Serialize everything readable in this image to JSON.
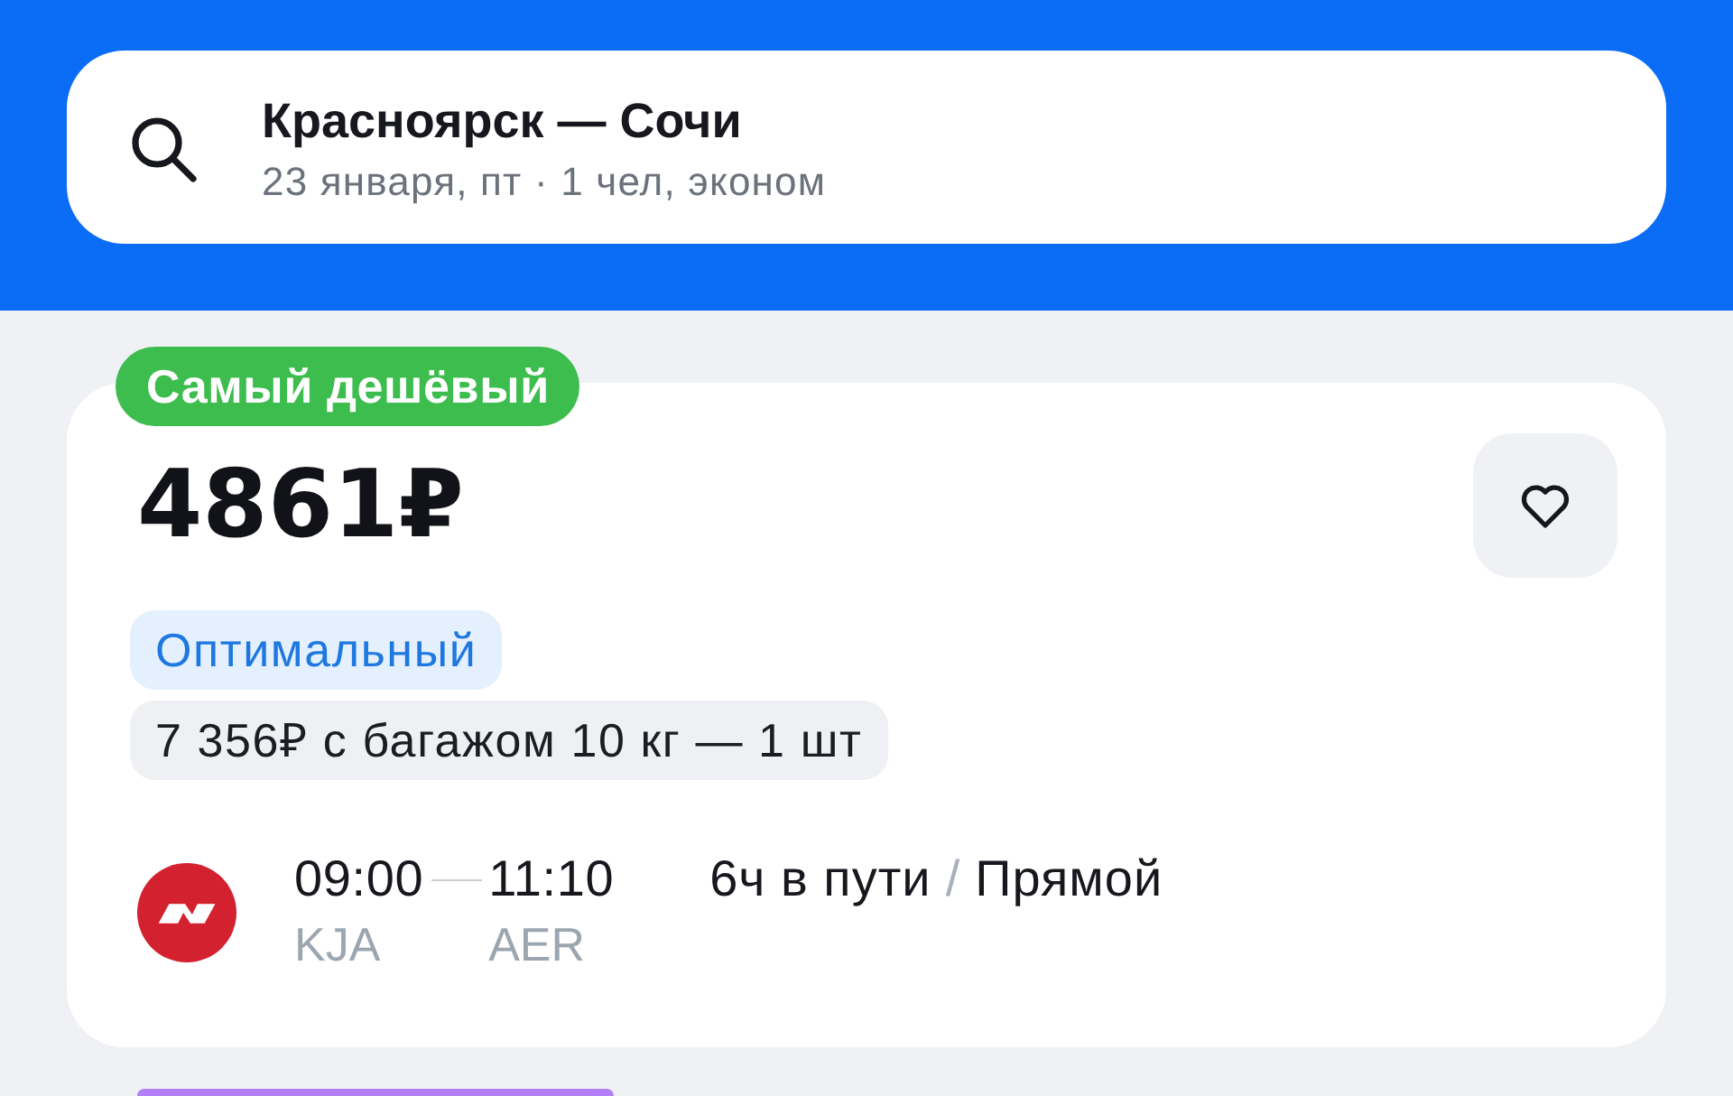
{
  "search": {
    "route": "Красноярск — Сочи",
    "details": "23 января, пт · 1 чел, эконом"
  },
  "offers": [
    {
      "badge": {
        "label": "Самый дешёвый",
        "color": "#3dbd4e"
      },
      "price": "4861₽",
      "favorite": false,
      "tags": [
        {
          "kind": "fare",
          "label": "Оптимальный"
        },
        {
          "kind": "baggage",
          "label": "7 356₽ с багажом 10 кг — 1 шт"
        }
      ],
      "flight": {
        "departure_time": "09:00",
        "arrival_time": "11:10",
        "departure_airport": "KJA",
        "arrival_airport": "AER",
        "duration": "6ч в пути",
        "separator": "/",
        "stops": "Прямой"
      }
    }
  ],
  "next_offer": {
    "badge": {
      "color": "#b37ef6"
    }
  }
}
